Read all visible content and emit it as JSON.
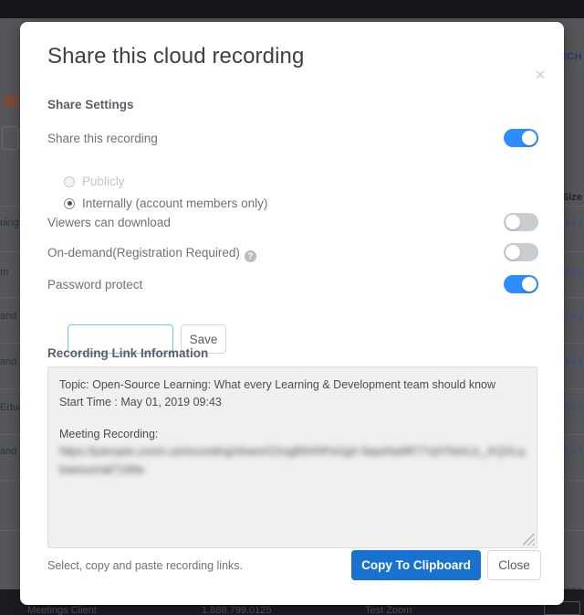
{
  "background": {
    "right_header_fragment": "SCH",
    "size_column_header": "Size",
    "left_row_fragments": [
      "ning",
      "m",
      "and",
      "and",
      "Educ",
      "and"
    ],
    "right_row_fragments": [
      "es (",
      "es (",
      "es (",
      "es (",
      "es (",
      "es ("
    ],
    "pagination_fragment": "age",
    "footer": {
      "meetings_client": "Meetings Client",
      "phone": "1.888.799.0125",
      "test_zoom": "Test Zoom"
    }
  },
  "modal": {
    "title": "Share this cloud recording",
    "close_icon": "close-icon",
    "close_glyph": "✕",
    "section_heading": "Share Settings",
    "settings": [
      {
        "label": "Share this recording",
        "state": "on"
      },
      {
        "label": "Viewers can download",
        "state": "off"
      },
      {
        "label": "On-demand(Registration Required)",
        "state": "off",
        "help_icon": "help-circle-icon",
        "help_glyph": "?"
      },
      {
        "label": "Password protect",
        "state": "on"
      }
    ],
    "visibility_options": [
      {
        "label": "Publicly",
        "checked": false,
        "disabled": true
      },
      {
        "label": "Internally (account members only)",
        "checked": true,
        "disabled": false
      }
    ],
    "password": {
      "value": "",
      "placeholder": "",
      "save_label": "Save"
    },
    "link_info": {
      "heading": "Recording Link Information",
      "topic_line": "Topic: Open-Source Learning: What every Learning & Development team should know",
      "start_time_line": "Start Time : May 01, 2019 09:43",
      "meeting_recording_label": "Meeting Recording:",
      "meeting_recording_url": "https://panopto.zoom.us/recording/share/O2og80HhPoGg0-3apsNa9R77njIY5ehLiL_KQXLqbawsumakTzMw"
    },
    "footer": {
      "hint": "Select, copy and paste recording links.",
      "copy_label": "Copy To Clipboard",
      "close_label": "Close"
    }
  },
  "colors": {
    "accent_blue": "#2d8cff",
    "primary_button": "#1a72d0",
    "toggle_off": "#c9ccd1",
    "focus_border": "#72c9e4"
  }
}
